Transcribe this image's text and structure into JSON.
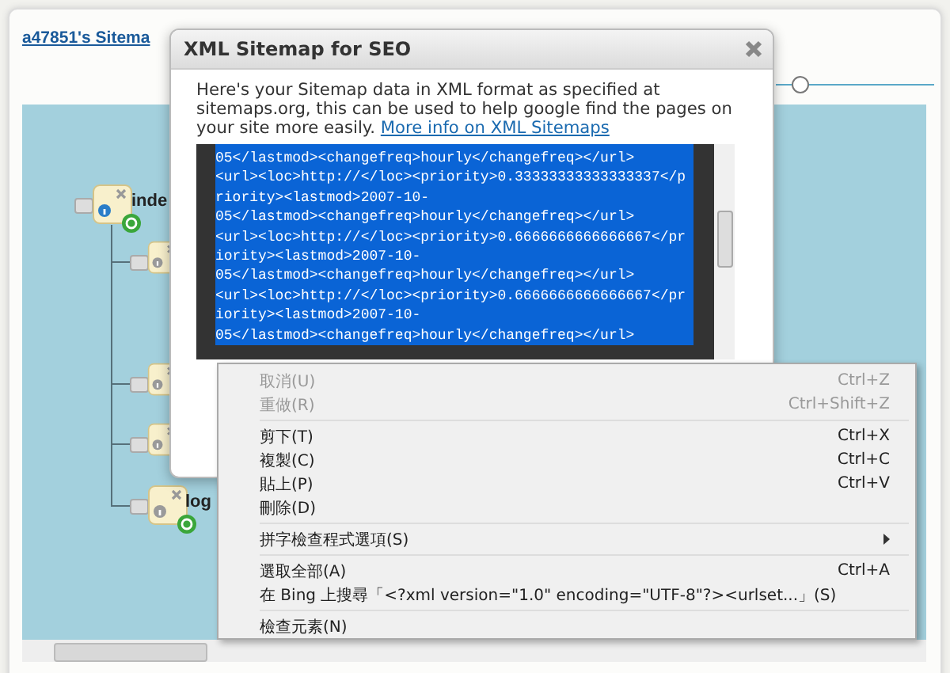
{
  "app": {
    "title": "a47851's Sitema",
    "zoom_slider": {
      "level": 0.15
    },
    "nodes": [
      {
        "kind": "root",
        "label": "inde"
      },
      {
        "kind": "child"
      },
      {
        "kind": "child"
      },
      {
        "kind": "child"
      },
      {
        "kind": "leaf",
        "label": "log"
      }
    ]
  },
  "dialog": {
    "title": "XML Sitemap for SEO",
    "description": "Here's your Sitemap data in XML format as specified at sitemaps.org, this can be used to help google find the pages on your site more easily.",
    "link": "More info on XML Sitemaps",
    "xml_lines": [
      "05</lastmod><changefreq>hourly</changefreq></url>",
      "<url><loc>http://</loc><priority>0.33333333333333337</p",
      "riority><lastmod>2007-10-",
      "05</lastmod><changefreq>hourly</changefreq></url>",
      "<url><loc>http://</loc><priority>0.6666666666666667</pr",
      "iority><lastmod>2007-10-",
      "05</lastmod><changefreq>hourly</changefreq></url>",
      "<url><loc>http://</loc><priority>0.6666666666666667</pr",
      "iority><lastmod>2007-10-",
      "05</lastmod><changefreq>hourly</changefreq></url>"
    ]
  },
  "context_menu": [
    {
      "kind": "item",
      "label": "取消(U)",
      "shortcut": "Ctrl+Z",
      "disabled": true
    },
    {
      "kind": "item",
      "label": "重做(R)",
      "shortcut": "Ctrl+Shift+Z",
      "disabled": true
    },
    {
      "kind": "separator"
    },
    {
      "kind": "item",
      "label": "剪下(T)",
      "shortcut": "Ctrl+X",
      "disabled": false
    },
    {
      "kind": "item",
      "label": "複製(C)",
      "shortcut": "Ctrl+C",
      "disabled": false
    },
    {
      "kind": "item",
      "label": "貼上(P)",
      "shortcut": "Ctrl+V",
      "disabled": false
    },
    {
      "kind": "item",
      "label": "刪除(D)",
      "disabled": false
    },
    {
      "kind": "separator"
    },
    {
      "kind": "submenu",
      "label": "拼字檢查程式選項(S)",
      "disabled": false
    },
    {
      "kind": "separator"
    },
    {
      "kind": "item",
      "label": "選取全部(A)",
      "shortcut": "Ctrl+A",
      "disabled": false
    },
    {
      "kind": "item",
      "label": "在 Bing 上搜尋「<?xml version=\"1.0\" encoding=\"UTF-8\"?><urlset...」(S)",
      "disabled": false
    },
    {
      "kind": "separator"
    },
    {
      "kind": "item",
      "label": "檢查元素(N)",
      "disabled": false
    }
  ]
}
